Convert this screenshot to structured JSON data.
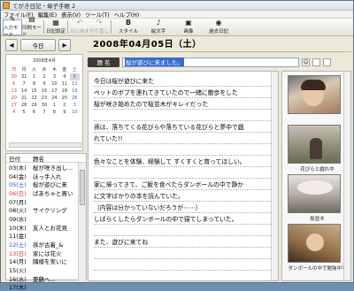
{
  "window": {
    "title": "てがき日記・母子手帳 2"
  },
  "menu": [
    "ファイル(F)",
    "編集(E)",
    "表示(V)",
    "ツール(T)",
    "ヘルプ(H)"
  ],
  "toolbar": {
    "items": [
      {
        "label": "入力モード",
        "icon": "pencil-icon"
      },
      {
        "label": "印刷モード",
        "icon": "print-icon"
      },
      {
        "label": "日記設定",
        "icon": "settings-icon"
      },
      {
        "label": "元に戻す",
        "icon": "undo-icon"
      },
      {
        "label": "やり直し",
        "icon": "redo-icon"
      },
      {
        "label": "スタイル",
        "icon": "style-icon"
      },
      {
        "label": "絵文字",
        "icon": "emoji-icon"
      },
      {
        "label": "画像",
        "icon": "image-icon"
      },
      {
        "label": "過去日記",
        "icon": "history-icon"
      }
    ]
  },
  "nav": {
    "today": "今日",
    "prev": "◀",
    "next": "▶"
  },
  "calendar": {
    "month_label": "2008年4月",
    "weekdays": [
      "日",
      "月",
      "火",
      "水",
      "木",
      "金",
      "土"
    ],
    "days": [
      "30",
      "31",
      "1",
      "2",
      "3",
      "4",
      "5",
      "6",
      "7",
      "8",
      "9",
      "10",
      "11",
      "12",
      "13",
      "14",
      "15",
      "16",
      "17",
      "18",
      "19",
      "20",
      "21",
      "22",
      "23",
      "24",
      "25",
      "26",
      "27",
      "28",
      "29",
      "30",
      "1",
      "2",
      "3",
      "4",
      "5",
      "6",
      "7",
      "8",
      "9",
      "10"
    ],
    "selected_index": 6
  },
  "list": {
    "col_date": "日付",
    "col_title": "題名",
    "rows": [
      {
        "date": "03(木)",
        "title": "桜が咲き出し..."
      },
      {
        "date": "04(金)",
        "title": "ほっ手入れ"
      },
      {
        "date": "05(土)",
        "title": "桜が遊びに来"
      },
      {
        "date": "06(日)",
        "title": "ばあちゃと買い"
      },
      {
        "date": "07(月)",
        "title": ""
      },
      {
        "date": "08(火)",
        "title": "サイクリング"
      },
      {
        "date": "09(水)",
        "title": ""
      },
      {
        "date": "10(木)",
        "title": "友人とお花見"
      },
      {
        "date": "11(金)",
        "title": ""
      },
      {
        "date": "12(土)",
        "title": "孫が古着_&"
      },
      {
        "date": "13(日)",
        "title": "家には花火"
      },
      {
        "date": "14(月)",
        "title": "隅様を実いに"
      },
      {
        "date": "15(火)",
        "title": ""
      },
      {
        "date": "16(水)",
        "title": "亜鶴へ..."
      },
      {
        "date": "17(木)",
        "title": ""
      }
    ]
  },
  "main": {
    "date": "2008年04月05日（土）",
    "title_label": "題 名",
    "title_value": "桜が遊びに来ました。",
    "lines": [
      "今日は桜が遊びに来た",
      "ペットのボブを連れてきていたので一緒に散歩をした",
      "桜が咲き始めたので桜並木がキレイだった",
      "",
      "孫は、落ちてくる花びらや落ちている花びらと夢中で戯",
      "れていた!!",
      "",
      "色々なことを体験、経験して すくすくと育ってほしい。",
      "",
      "家に帰ってきて、ご飯を食べたらダンボールの中で静か",
      "に文字ばかりの本を読んでいた。",
      "（内容は分かっていないだろうが⋯⋯）",
      "しばらくしたらダンボールの中で寝てしまっていた。",
      "",
      "また、遊びに来てね",
      "",
      "",
      ""
    ]
  },
  "photos": {
    "captions": [
      "",
      "花びらと戯れ中",
      "桜並木",
      "ダンボールの中で勉強中？"
    ]
  }
}
